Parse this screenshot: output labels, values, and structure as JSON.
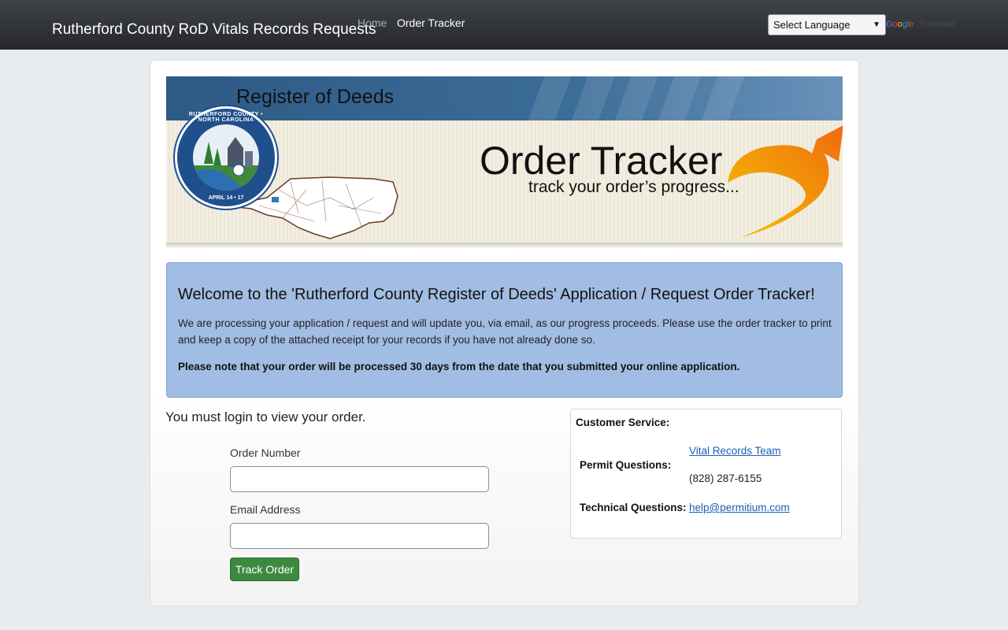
{
  "navbar": {
    "brand": "Rutherford County RoD Vitals Records Requests",
    "links": [
      "Home",
      "Order Tracker"
    ],
    "language_select": "Select Language",
    "google": [
      "G",
      "o",
      "o",
      "g",
      "l",
      "e"
    ],
    "translate": "Translate"
  },
  "banner": {
    "header": "Register of Deeds",
    "title": "Order Tracker",
    "subtitle": "track your order’s progress...",
    "seal_top": "RUTHERFORD COUNTY • NORTH CAROLINA",
    "seal_bottom": "APRIL 14 • 17"
  },
  "welcome": {
    "heading": "Welcome to the 'Rutherford County Register of Deeds' Application / Request Order Tracker!",
    "body": "We are processing your application / request and will update you, via email, as our progress proceeds. Please use the order tracker to print and keep a copy of the attached receipt for your records if you have not already done so.",
    "note": "Please note that your order will be processed 30 days from the date that you submitted your online application."
  },
  "login": {
    "title": "You must login to view your order.",
    "order_label": "Order Number",
    "order_value": "",
    "email_label": "Email Address",
    "email_value": "",
    "button": "Track Order"
  },
  "customer_service": {
    "title": "Customer Service:",
    "permit_label": "Permit Questions:",
    "permit_link": "Vital Records Team",
    "permit_phone": "(828) 287-6155",
    "tech_label": "Technical Questions:",
    "tech_email": "help@permitium.com"
  },
  "colors": {
    "navbar": "#2f3235",
    "welcome_bg": "#a2bde3",
    "button": "#3d8a3f",
    "link": "#1a5fb4"
  }
}
